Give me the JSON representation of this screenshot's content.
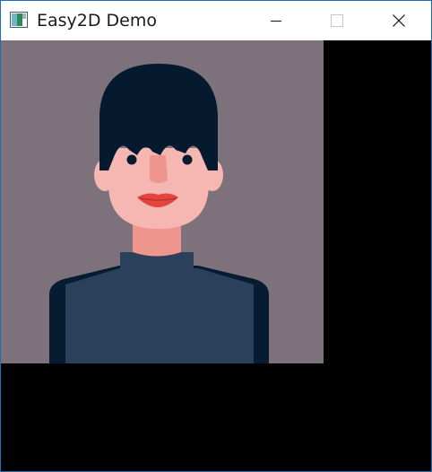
{
  "window": {
    "title": "Easy2D Demo",
    "controls": {
      "minimize_icon": "minimize-icon",
      "maximize_icon": "maximize-icon",
      "close_icon": "close-icon"
    }
  },
  "scene": {
    "background_color": "#000000",
    "panel_color": "#7d727b",
    "hair_color": "#061a2f",
    "skin_color": "#f6b7b3",
    "neck_color": "#ee958d",
    "lip_color": "#e4433e",
    "sweater_color": "#2b405a",
    "sweater_dark_color": "#081c31"
  }
}
